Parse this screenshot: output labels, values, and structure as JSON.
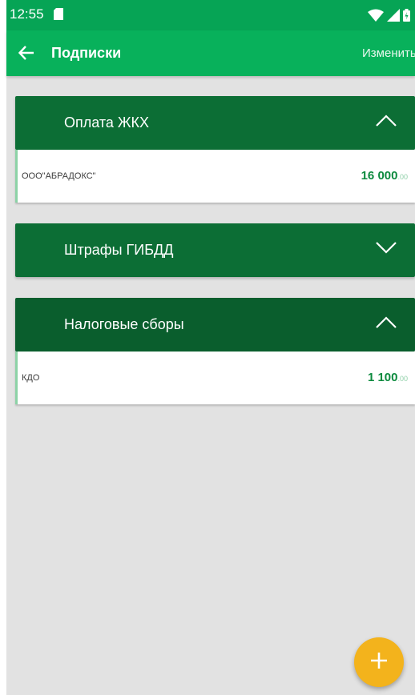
{
  "status_bar": {
    "time": "12:55"
  },
  "app_bar": {
    "title": "Подписки",
    "edit_label": "Изменить"
  },
  "groups": [
    {
      "title": "Оплата ЖКХ",
      "expanded": true,
      "items": [
        {
          "name": "ООО\"АБРАДОКС\"",
          "amount_main": "16 000",
          "amount_cents": ".00"
        }
      ]
    },
    {
      "title": "Штрафы ГИБДД",
      "expanded": false,
      "items": []
    },
    {
      "title": "Налоговые сборы",
      "expanded": true,
      "items": [
        {
          "name": "КДО",
          "amount_main": "1 100",
          "amount_cents": ".00"
        }
      ]
    }
  ],
  "colors": {
    "status_bar": "#06a455",
    "app_bar": "#08b15b",
    "group_header": "#0c6e35",
    "amount": "#0c8a3e",
    "fab": "#f3b31c"
  },
  "icons": {
    "back": "arrow-left-icon",
    "expanded": "chevron-up-icon",
    "collapsed": "chevron-down-icon",
    "fab": "plus-icon"
  }
}
